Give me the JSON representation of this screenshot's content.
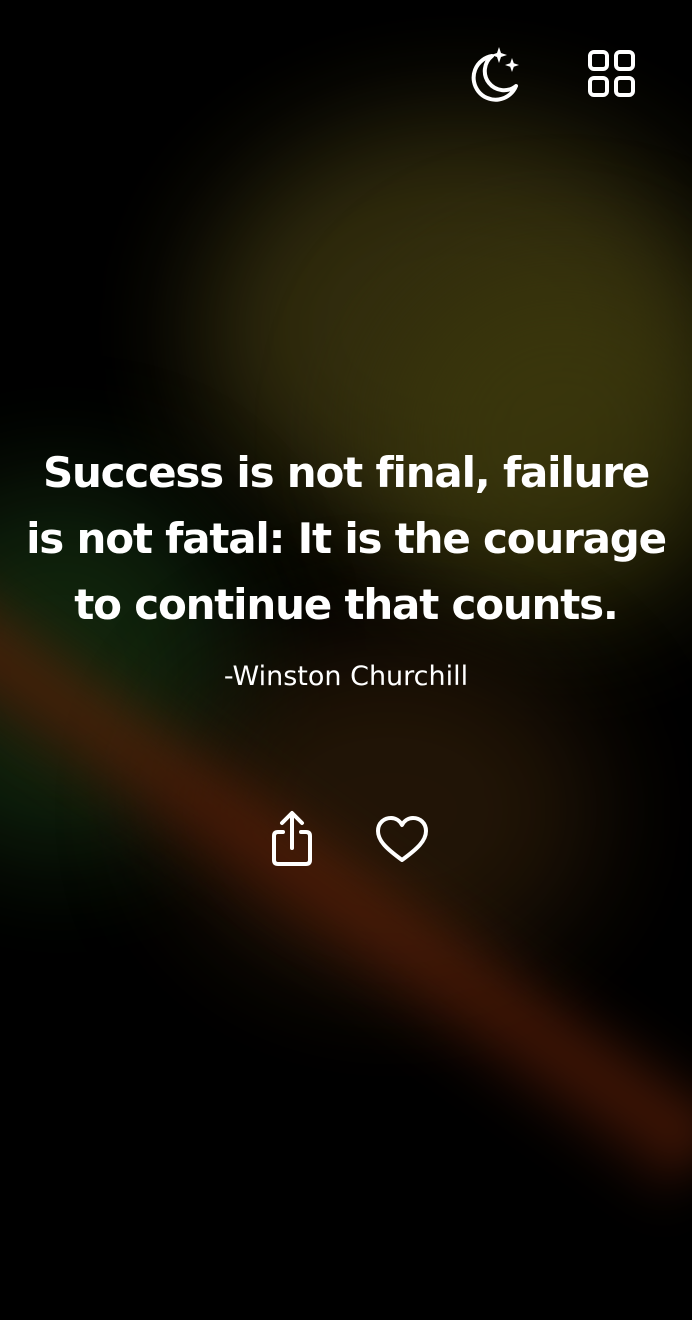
{
  "quote": {
    "text": "Success is not final, failure is not fatal: It is the courage to continue that counts.",
    "author": "-Winston Churchill"
  },
  "toolbar": {
    "theme_icon": "moon-stars-icon",
    "menu_icon": "grid-icon"
  },
  "actions": {
    "share_icon": "share-icon",
    "like_icon": "heart-icon"
  },
  "colors": {
    "background": "#000000",
    "text": "#ffffff",
    "accent_olive": "#3a3410",
    "accent_rust": "#5f2008",
    "accent_green": "#12280e"
  }
}
